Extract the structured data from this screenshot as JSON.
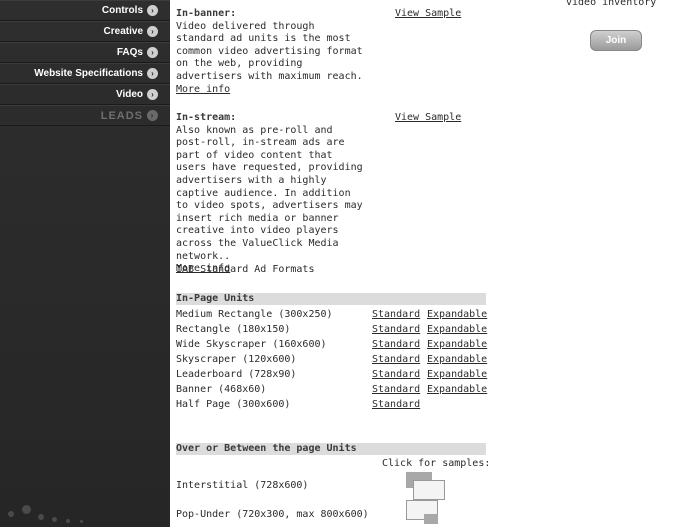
{
  "sidebar": {
    "items": [
      {
        "label": "Controls",
        "muted": false
      },
      {
        "label": "Creative",
        "muted": false
      },
      {
        "label": "FAQs",
        "muted": false
      },
      {
        "label": "Website Specifications",
        "muted": false
      },
      {
        "label": "Video",
        "muted": false
      },
      {
        "label": "LEADS",
        "muted": true
      }
    ]
  },
  "topright": {
    "text": "video inventory",
    "join_label": "Join"
  },
  "inbanner": {
    "title": "In-banner:",
    "body": "Video delivered through standard ad units is the most common video advertising format on the web, providing advertisers with maximum reach.",
    "more": "More info",
    "sample": "View Sample"
  },
  "instream": {
    "title": "In-stream:",
    "body": "Also known as pre-roll and post-roll, in-stream ads are part of video content that users have requested, providing advertisers with a highly captive audience. In addition to video spots, advertisers may insert rich media or banner creative into video players across the ValueClick Media network..",
    "more": "More info",
    "sample": "View Sample"
  },
  "iab_label": "IAB Standard Ad Formats",
  "inpage": {
    "header": "In-Page Units",
    "rows": [
      {
        "name": "Medium Rectangle (300x250)",
        "std": "Standard",
        "exp": "Expandable"
      },
      {
        "name": "Rectangle (180x150)",
        "std": "Standard",
        "exp": "Expandable"
      },
      {
        "name": "Wide Skyscraper (160x600)",
        "std": "Standard",
        "exp": "Expandable"
      },
      {
        "name": "Skyscraper (120x600)",
        "std": "Standard",
        "exp": "Expandable"
      },
      {
        "name": "Leaderboard (728x90)",
        "std": "Standard",
        "exp": "Expandable"
      },
      {
        "name": "Banner (468x60)",
        "std": "Standard",
        "exp": "Expandable"
      },
      {
        "name": "Half Page (300x600)",
        "std": "Standard",
        "exp": ""
      }
    ]
  },
  "between": {
    "header": "Over or Between the page Units",
    "click_for": "Click for samples:",
    "rows": [
      {
        "name": "Interstitial (728x600)"
      },
      {
        "name": "Pop-Under (720x300, max 800x600)"
      }
    ]
  }
}
